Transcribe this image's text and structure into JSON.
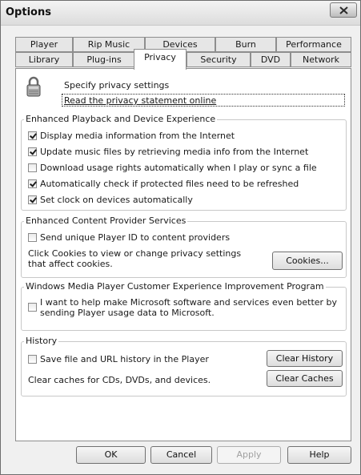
{
  "window": {
    "title": "Options"
  },
  "tabs": {
    "row1": [
      "Player",
      "Rip Music",
      "Devices",
      "Burn",
      "Performance"
    ],
    "row2": [
      "Library",
      "Plug-ins",
      "Privacy",
      "Security",
      "DVD",
      "Network"
    ],
    "active": "Privacy"
  },
  "privacy_header": {
    "icon": "padlock-icon",
    "title": "Specify privacy settings",
    "link": "Read the privacy statement online"
  },
  "enhanced_playback": {
    "label": "Enhanced Playback and Device Experience",
    "items": [
      {
        "label": "Display media information from the Internet",
        "checked": true
      },
      {
        "label": "Update music files by retrieving media info from the Internet",
        "checked": true
      },
      {
        "label": "Download usage rights automatically when I play or sync a file",
        "checked": false
      },
      {
        "label": "Automatically check if protected files need to be refreshed",
        "checked": true
      },
      {
        "label": "Set clock on devices automatically",
        "checked": true
      }
    ]
  },
  "content_provider": {
    "label": "Enhanced Content Provider Services",
    "checkbox": {
      "label": "Send unique Player ID to content providers",
      "checked": false
    },
    "description_line1": "Click Cookies to view or change privacy settings",
    "description_line2": "that affect cookies.",
    "button": "Cookies..."
  },
  "ceip": {
    "label": "Windows Media Player Customer Experience Improvement Program",
    "checkbox": {
      "line1": "I want to help make Microsoft software and services even better by",
      "line2": "sending Player usage data to Microsoft.",
      "checked": false
    }
  },
  "history": {
    "label": "History",
    "checkbox": {
      "label": "Save file and URL history in the Player",
      "checked": false
    },
    "clear_history_button": "Clear History",
    "caches_text": "Clear caches for CDs, DVDs, and devices.",
    "clear_caches_button": "Clear Caches"
  },
  "footer_buttons": {
    "ok": "OK",
    "cancel": "Cancel",
    "apply": "Apply",
    "help": "Help"
  }
}
